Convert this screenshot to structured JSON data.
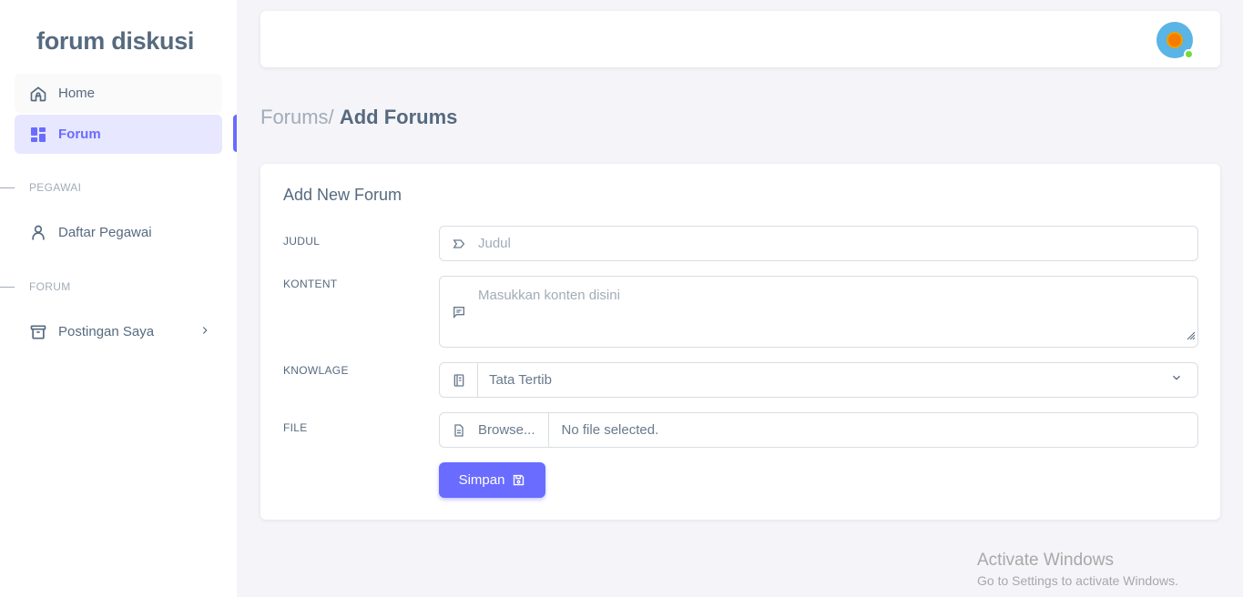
{
  "sidebar": {
    "brand": "forum diskusi",
    "items": [
      {
        "label": "Home",
        "icon": "home-icon"
      },
      {
        "label": "Forum",
        "icon": "layout-grid-icon",
        "active": true
      }
    ],
    "sections": [
      {
        "header": "PEGAWAI",
        "items": [
          {
            "label": "Daftar Pegawai",
            "icon": "user-icon"
          }
        ]
      },
      {
        "header": "FORUM",
        "items": [
          {
            "label": "Postingan Saya",
            "icon": "archive-icon"
          }
        ]
      }
    ]
  },
  "navbar": {
    "avatar": "user-avatar",
    "status_color": "#71dd37"
  },
  "breadcrumb": {
    "parent": "Forums/",
    "current": "Add Forums"
  },
  "form": {
    "title": "Add New Forum",
    "judul": {
      "label": "JUDUL",
      "placeholder": "Judul"
    },
    "konten": {
      "label": "KONTENT",
      "placeholder": "Masukkan konten disini"
    },
    "knowlage": {
      "label": "KNOWLAGE",
      "value": "Tata Tertib"
    },
    "file": {
      "label": "FILE",
      "button": "Browse...",
      "status": "No file selected."
    },
    "submit": "Simpan"
  },
  "watermark": {
    "title": "Activate Windows",
    "subtitle": "Go to Settings to activate Windows."
  },
  "colors": {
    "accent": "#696cff",
    "text": "#566a7f",
    "muted": "#a1acb8",
    "background": "#f5f5f9"
  }
}
